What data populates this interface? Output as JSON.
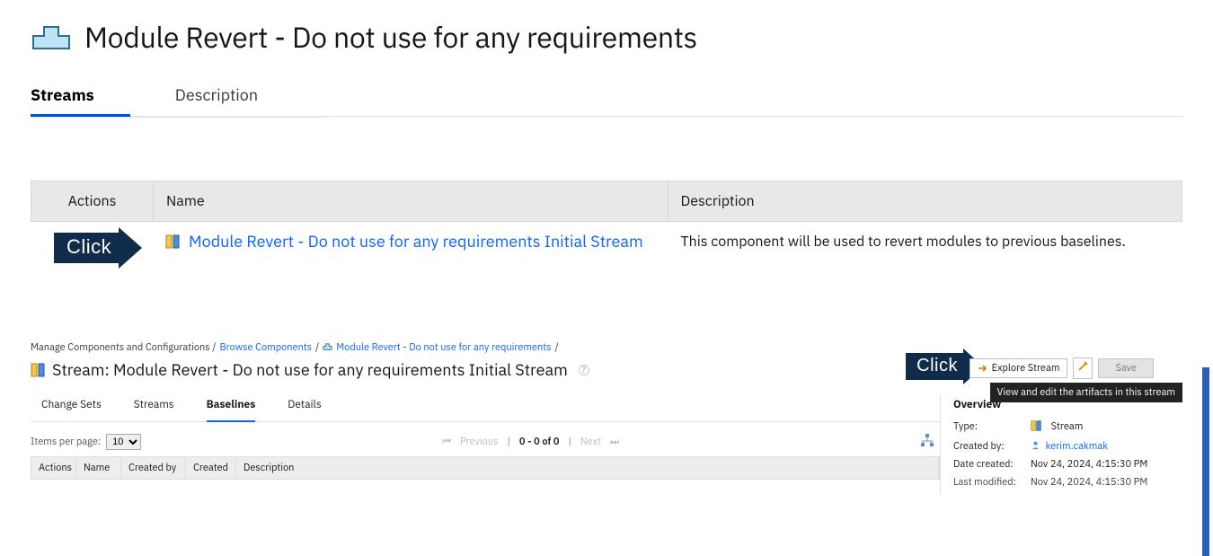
{
  "header": {
    "title": "Module Revert - Do not use for any requirements"
  },
  "tabs": {
    "streams": "Streams",
    "description": "Description"
  },
  "streams_table": {
    "col_actions": "Actions",
    "col_name": "Name",
    "col_desc": "Description",
    "row0": {
      "name": "Module Revert - Do not use for any requirements Initial Stream",
      "desc": "This component will be used to revert modules to previous baselines."
    }
  },
  "annotations": {
    "click": "Click"
  },
  "breadcrumb": {
    "root": "Manage Components and Configurations /",
    "browse": "Browse Components",
    "sep": "/",
    "component": "Module Revert - Do not use for any requirements"
  },
  "stream_detail": {
    "prefix": "Stream:",
    "name": "Module Revert - Do not use for any requirements Initial Stream"
  },
  "toolbar": {
    "explore": "Explore Stream",
    "save": "Save",
    "tooltip": "View and edit the artifacts in this stream"
  },
  "subtabs": {
    "changesets": "Change Sets",
    "streams": "Streams",
    "baselines": "Baselines",
    "details": "Details"
  },
  "pager": {
    "items_label": "Items per page:",
    "size": "10",
    "previous": "Previous",
    "range": "0 - 0 of 0",
    "next": "Next"
  },
  "baseline_cols": {
    "actions": "Actions",
    "name": "Name",
    "created_by": "Created by",
    "created": "Created",
    "description": "Description"
  },
  "overview": {
    "heading": "Overview",
    "type_k": "Type:",
    "type_v": "Stream",
    "created_by_k": "Created by:",
    "created_by_v": "kerim.cakmak",
    "date_created_k": "Date created:",
    "date_created_v": "Nov 24, 2024, 4:15:30 PM",
    "last_mod_k": "Last modified:",
    "last_mod_v": "Nov 24, 2024, 4:15:30 PM"
  }
}
